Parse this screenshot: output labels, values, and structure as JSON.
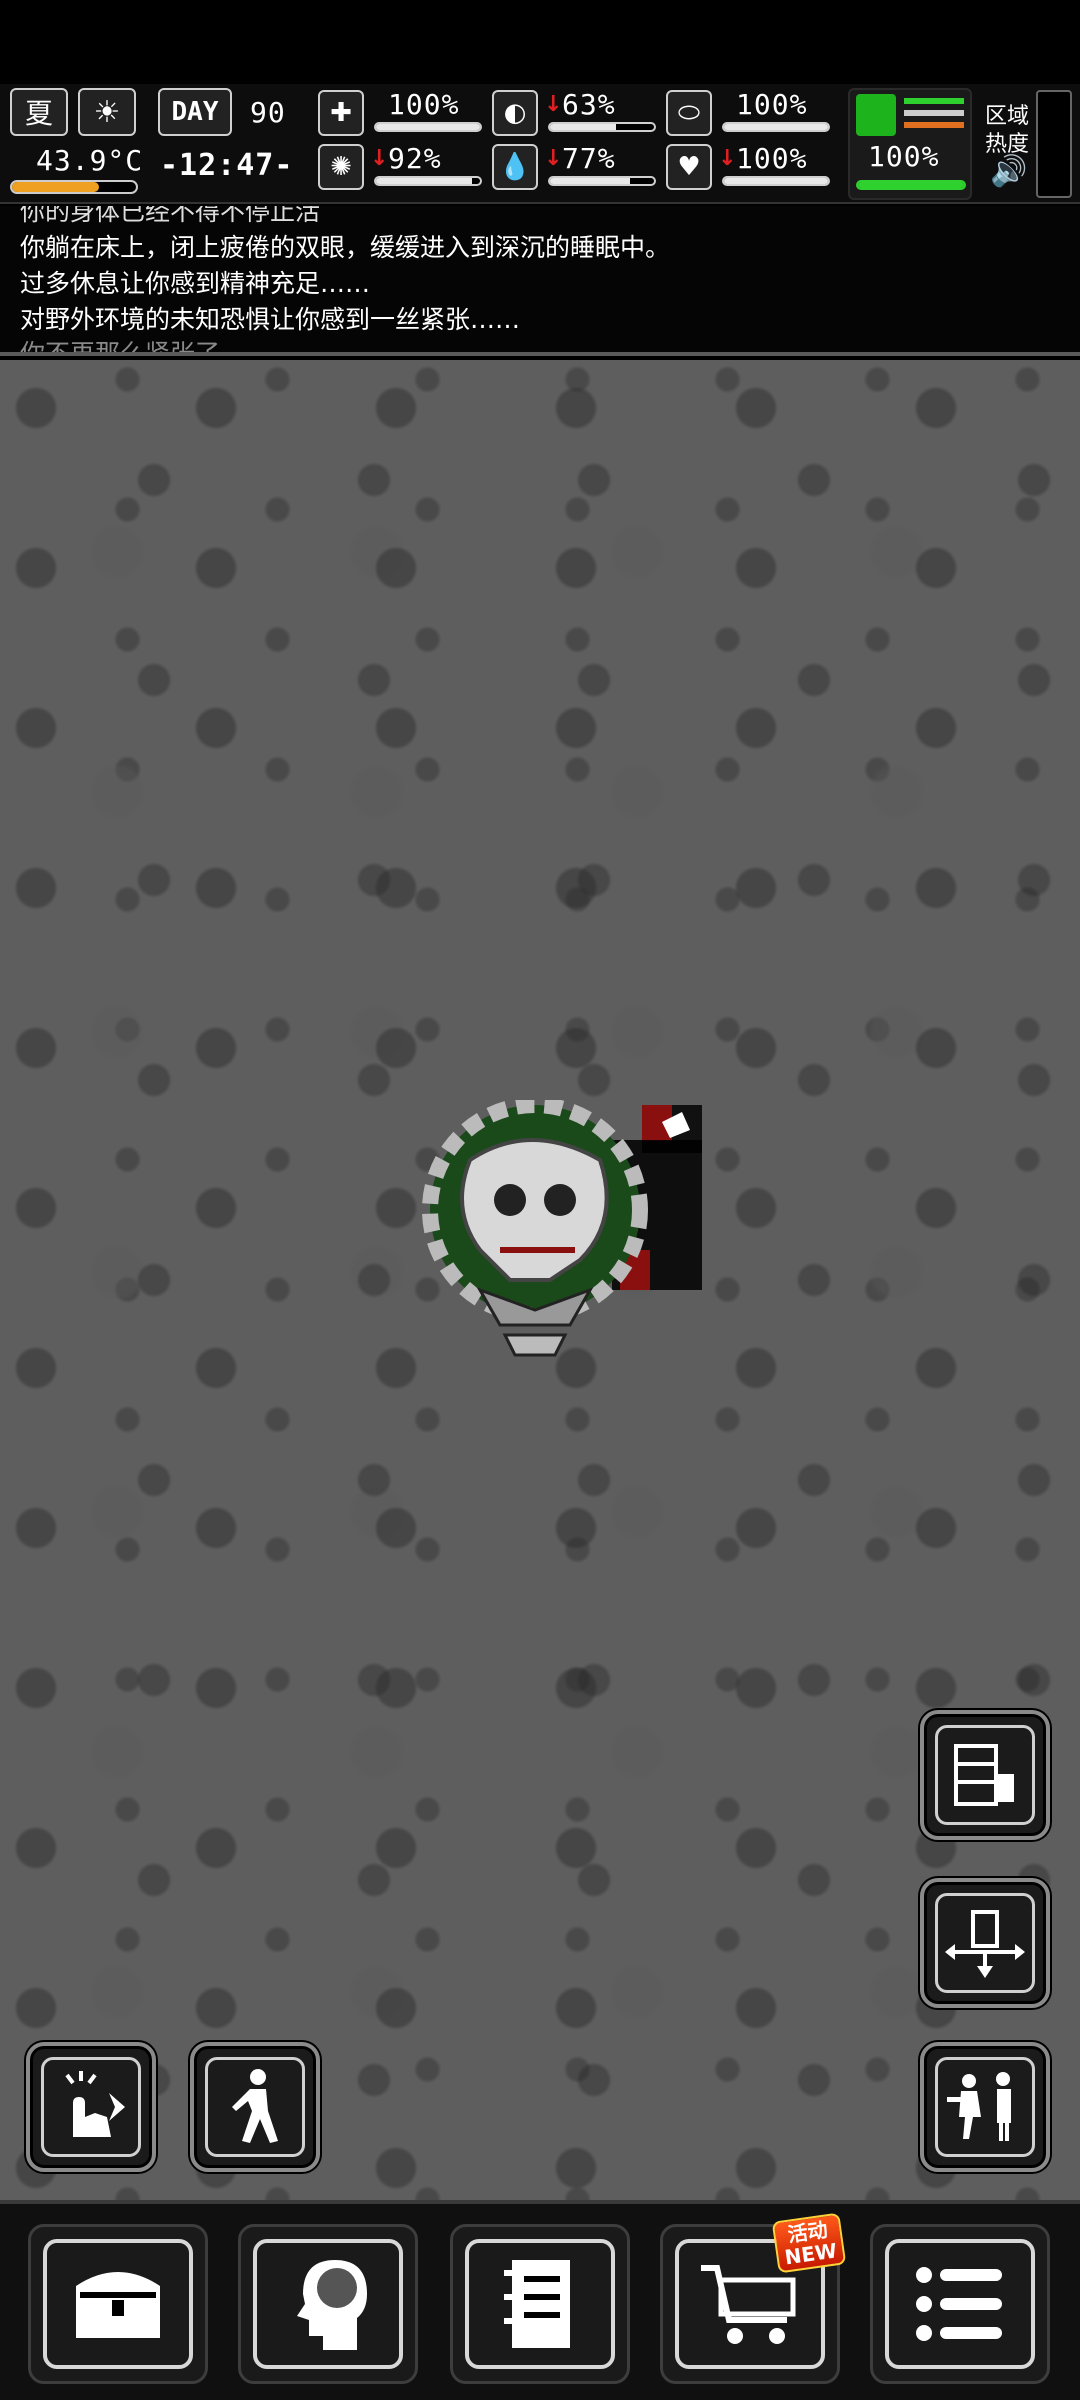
{
  "hud": {
    "season": "夏",
    "temperature": "43.9°C",
    "day_label": "DAY",
    "day_number": "90",
    "clock": "-12:47-",
    "stats": [
      {
        "name": "health",
        "icon": "medkit-icon",
        "value": "100%",
        "level": 1.0,
        "trend": "none"
      },
      {
        "name": "hunger",
        "icon": "stomach-icon",
        "value": "63%",
        "level": 0.63,
        "trend": "down"
      },
      {
        "name": "pill",
        "icon": "pill-icon",
        "value": "100%",
        "level": 1.0,
        "trend": "none"
      },
      {
        "name": "sanity",
        "icon": "brain-icon",
        "value": "92%",
        "level": 0.92,
        "trend": "down"
      },
      {
        "name": "thirst",
        "icon": "water-drop-icon",
        "value": "77%",
        "level": 0.77,
        "trend": "down"
      },
      {
        "name": "heart",
        "icon": "heart-icon",
        "value": "100%",
        "level": 1.0,
        "trend": "down"
      }
    ],
    "stamina_value": "100%",
    "stamina_level": 1.0,
    "zone_label_1": "区域",
    "zone_label_2": "热度"
  },
  "log": {
    "lines": [
      "你的身体已经不得不停止活",
      "你躺在床上，闭上疲倦的双眼，缓缓进入到深沉的睡眠中。",
      "过多休息让你感到精神充足……",
      "对野外环境的未知恐惧让你感到一丝紧张……",
      "你不再那么紧张了……"
    ]
  },
  "bottom": {
    "shop_badge_1": "活动",
    "shop_badge_2": "NEW"
  },
  "colors": {
    "accent_red": "#e02020",
    "stamina_green": "#2fd12f",
    "map_gray": "#5e5e5e"
  }
}
